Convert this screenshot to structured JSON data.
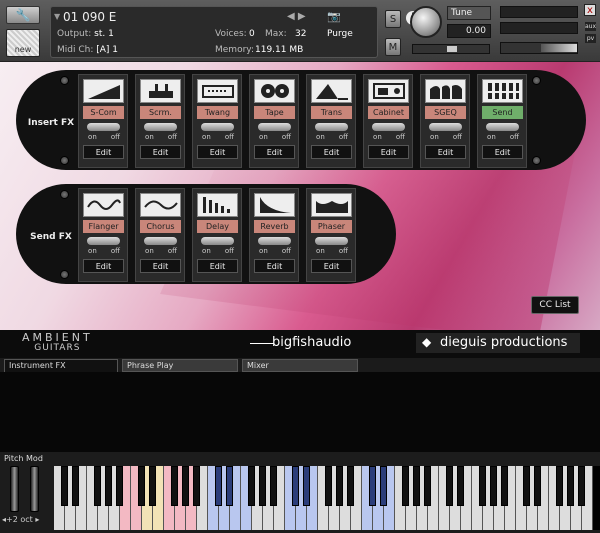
{
  "header": {
    "instrument_name": "01 090 E",
    "output_label": "Output:",
    "output_value": "st. 1",
    "voices_label": "Voices:",
    "voices_value": "0",
    "max_label": "Max:",
    "max_value": "32",
    "purge_label": "Purge",
    "midi_label": "Midi Ch:",
    "midi_value": "[A] 1",
    "memory_label": "Memory:",
    "memory_value": "119.11 MB",
    "new_label": "new",
    "s_label": "S",
    "m_label": "M",
    "tune_label": "Tune",
    "tune_value": "0.00",
    "close_label": "x",
    "aux_label": "aux",
    "pv_label": "pv"
  },
  "insert_fx": {
    "label": "Insert FX",
    "modules": [
      {
        "name": "S-Com",
        "on": "on",
        "off": "off",
        "edit": "Edit"
      },
      {
        "name": "Scrm.",
        "on": "on",
        "off": "off",
        "edit": "Edit"
      },
      {
        "name": "Twang",
        "on": "on",
        "off": "off",
        "edit": "Edit"
      },
      {
        "name": "Tape",
        "on": "on",
        "off": "off",
        "edit": "Edit"
      },
      {
        "name": "Trans",
        "on": "on",
        "off": "off",
        "edit": "Edit"
      },
      {
        "name": "Cabinet",
        "on": "on",
        "off": "off",
        "edit": "Edit"
      },
      {
        "name": "SGEQ",
        "on": "on",
        "off": "off",
        "edit": "Edit"
      },
      {
        "name": "Send",
        "on": "on",
        "off": "off",
        "edit": "Edit"
      }
    ]
  },
  "send_fx": {
    "label": "Send FX",
    "modules": [
      {
        "name": "Flanger",
        "on": "on",
        "off": "off",
        "edit": "Edit"
      },
      {
        "name": "Chorus",
        "on": "on",
        "off": "off",
        "edit": "Edit"
      },
      {
        "name": "Delay",
        "on": "on",
        "off": "off",
        "edit": "Edit"
      },
      {
        "name": "Reverb",
        "on": "on",
        "off": "off",
        "edit": "Edit"
      },
      {
        "name": "Phaser",
        "on": "on",
        "off": "off",
        "edit": "Edit"
      }
    ]
  },
  "cc_list": "CC List",
  "logos": {
    "ambient": "AMBIENT",
    "guitars": "GUITARS",
    "bigfish": "bigfishaudio",
    "dieguis": "dieguis productions"
  },
  "tabs": [
    {
      "label": "Instrument FX"
    },
    {
      "label": "Phrase Play"
    },
    {
      "label": "Mixer"
    }
  ],
  "keyboard": {
    "pitch_mod": "Pitch Mod",
    "octave": "◂+2 oct ▸"
  }
}
